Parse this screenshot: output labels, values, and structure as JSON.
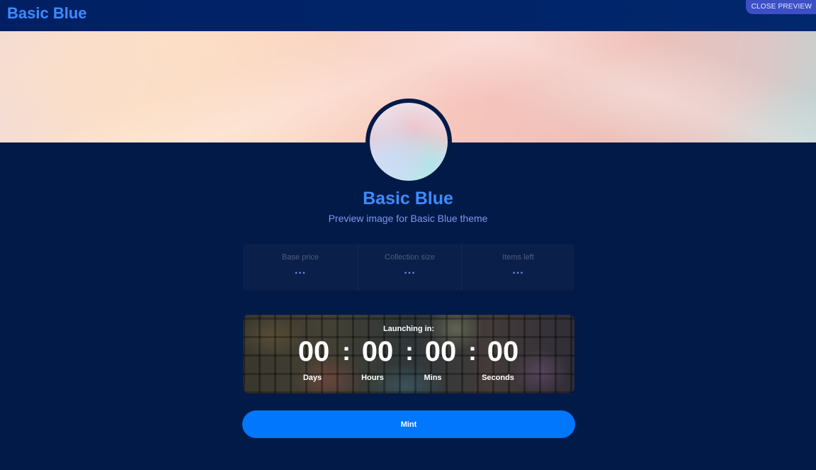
{
  "header": {
    "brand": "Basic Blue",
    "close_preview_label": "CLOSE PREVIEW"
  },
  "profile": {
    "title": "Basic Blue",
    "subtitle": "Preview image for Basic Blue theme"
  },
  "stats": [
    {
      "label": "Base price",
      "value": "..."
    },
    {
      "label": "Collection size",
      "value": "..."
    },
    {
      "label": "Items left",
      "value": "..."
    }
  ],
  "countdown": {
    "label": "Launching in:",
    "days": "00",
    "hours": "00",
    "mins": "00",
    "seconds": "00",
    "separator": ":",
    "units": {
      "days": "Days",
      "hours": "Hours",
      "mins": "Mins",
      "seconds": "Seconds"
    }
  },
  "mint": {
    "label": "Mint"
  },
  "colors": {
    "background": "#011a48",
    "accent": "#3e8bff",
    "mint_button": "#0177fe",
    "close_preview": "#3d4fc4"
  }
}
